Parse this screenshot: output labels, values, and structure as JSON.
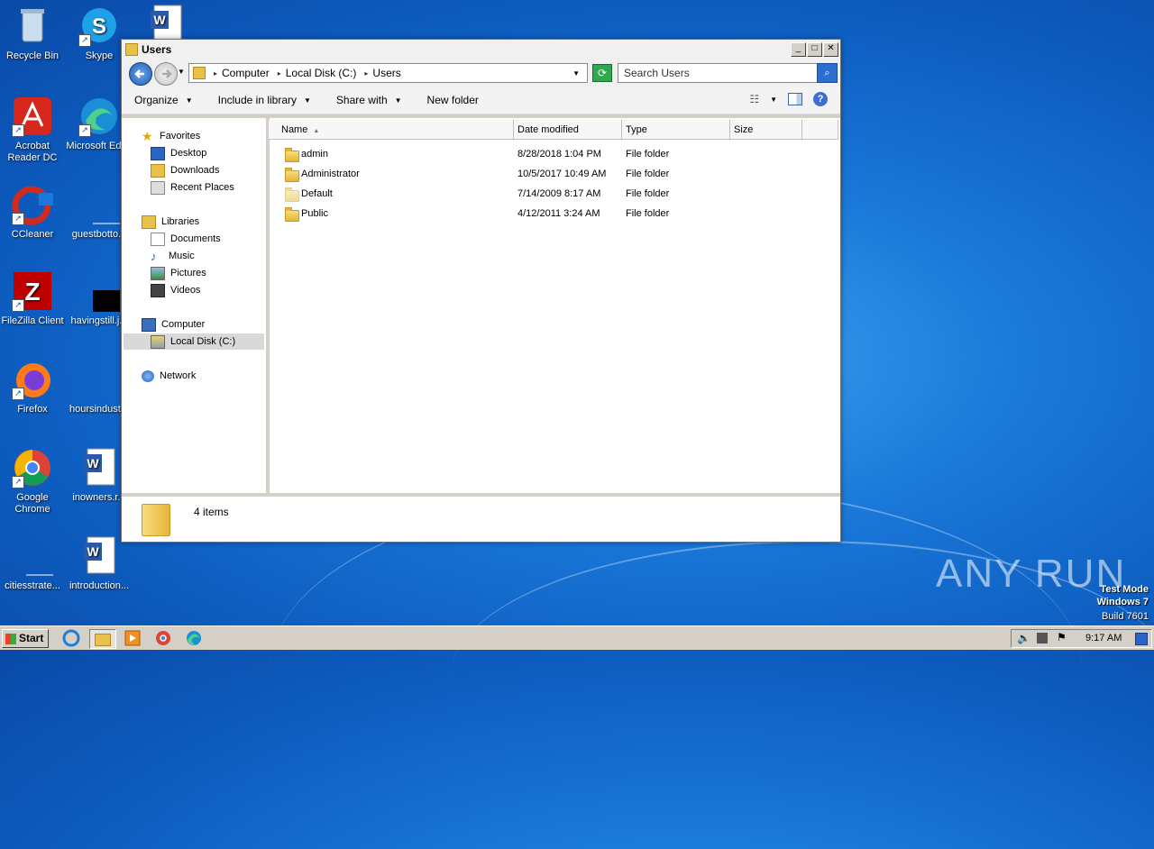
{
  "desktop": {
    "icons": [
      {
        "label": "Recycle Bin",
        "icon": "recycle-bin-icon"
      },
      {
        "label": "Skype",
        "icon": "skype-icon"
      },
      {
        "label": "Acrobat Reader DC",
        "icon": "acrobat-icon"
      },
      {
        "label": "Microsoft Edge",
        "icon": "edge-icon"
      },
      {
        "label": "CCleaner",
        "icon": "ccleaner-icon"
      },
      {
        "label": "guestbotto...",
        "icon": "file-icon"
      },
      {
        "label": "FileZilla Client",
        "icon": "filezilla-icon"
      },
      {
        "label": "havingstill.j...",
        "icon": "image-icon"
      },
      {
        "label": "Firefox",
        "icon": "firefox-icon"
      },
      {
        "label": "hoursindust...",
        "icon": "file-icon"
      },
      {
        "label": "Google Chrome",
        "icon": "chrome-icon"
      },
      {
        "label": "inowners.r...",
        "icon": "word-doc-icon"
      },
      {
        "label": "citiesstrate...",
        "icon": "file-icon"
      },
      {
        "label": "introduction...",
        "icon": "word-doc-icon"
      },
      {
        "label": "",
        "icon": "word-doc-icon"
      }
    ]
  },
  "window": {
    "title": "Users",
    "address": {
      "crumbs": [
        "Computer",
        "Local Disk (C:)",
        "Users"
      ]
    },
    "search": {
      "placeholder": "Search Users"
    },
    "toolbar": {
      "organize": "Organize",
      "include_in_library": "Include in library",
      "share_with": "Share with",
      "new_folder": "New folder"
    },
    "nav": {
      "favorites": "Favorites",
      "desktop": "Desktop",
      "downloads": "Downloads",
      "recent_places": "Recent Places",
      "libraries": "Libraries",
      "documents": "Documents",
      "music": "Music",
      "pictures": "Pictures",
      "videos": "Videos",
      "computer": "Computer",
      "local_disk": "Local Disk (C:)",
      "network": "Network"
    },
    "columns": {
      "name": "Name",
      "date_modified": "Date modified",
      "type": "Type",
      "size": "Size"
    },
    "rows": [
      {
        "name": "admin",
        "date": "8/28/2018 1:04 PM",
        "type": "File folder"
      },
      {
        "name": "Administrator",
        "date": "10/5/2017 10:49 AM",
        "type": "File folder"
      },
      {
        "name": "Default",
        "date": "7/14/2009 8:17 AM",
        "type": "File folder"
      },
      {
        "name": "Public",
        "date": "4/12/2011 3:24 AM",
        "type": "File folder"
      }
    ],
    "status": {
      "count": "4 items"
    }
  },
  "taskbar": {
    "start": "Start",
    "clock": "9:17 AM"
  },
  "overlay": {
    "watermark": "ANY RUN",
    "testmode_line1": "Test Mode",
    "testmode_line2": "Windows 7",
    "testmode_line3": "Build 7601"
  }
}
